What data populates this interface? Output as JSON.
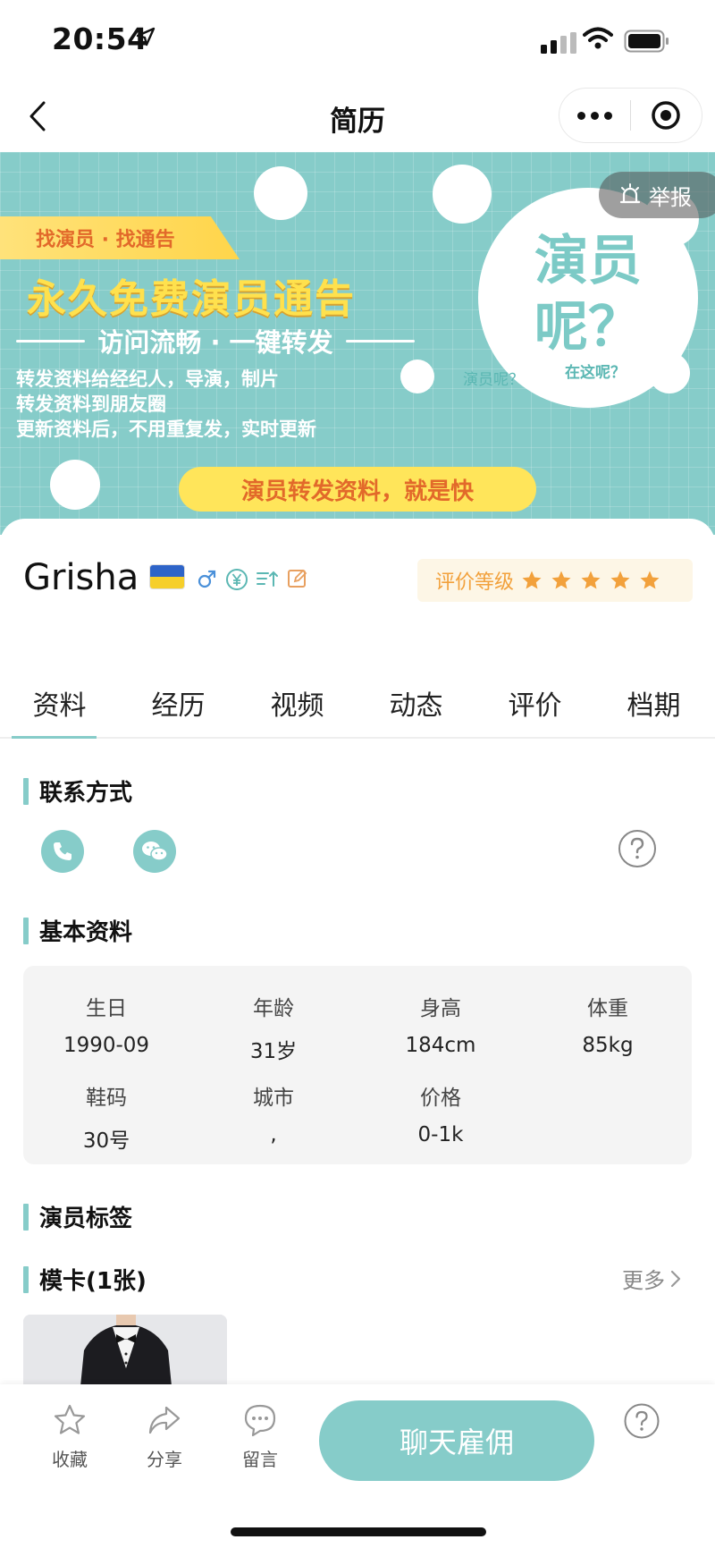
{
  "status_bar": {
    "time": "20:54"
  },
  "nav": {
    "title": "简历"
  },
  "banner": {
    "tag": "找演员 · 找通告",
    "headline": "永久免费演员通告",
    "subline": "访问流畅 · 一键转发",
    "lines": [
      "转发资料给经纪人，导演，制片",
      "转发资料到朋友圈",
      "更新资料后，不用重复发，实时更新"
    ],
    "pill": "演员转发资料，就是快",
    "bubble": "演员呢？",
    "caption_left": "演员呢？",
    "caption_right": "在这呢？",
    "report_label": "举报"
  },
  "profile": {
    "name": "Grisha",
    "rating_label": "评价等级",
    "rating_stars": 5
  },
  "tabs": [
    "资料",
    "经历",
    "视频",
    "动态",
    "评价",
    "档期"
  ],
  "sections": {
    "contact": "联系方式",
    "basic": "基本资料",
    "tags": "演员标签",
    "model_card": "模卡(1张)",
    "more": "更多"
  },
  "basic_info": [
    {
      "label": "生日",
      "value": "1990-09"
    },
    {
      "label": "年龄",
      "value": "31岁"
    },
    {
      "label": "身高",
      "value": "184cm"
    },
    {
      "label": "体重",
      "value": "85kg"
    },
    {
      "label": "鞋码",
      "value": "30号"
    },
    {
      "label": "城市",
      "value": ","
    },
    {
      "label": "价格",
      "value": "0-1k"
    }
  ],
  "bottom_bar": {
    "favorite": "收藏",
    "share": "分享",
    "message": "留言",
    "chat": "聊天雇佣"
  },
  "colors": {
    "accent": "#86ccc9",
    "star": "#f2a13c"
  }
}
